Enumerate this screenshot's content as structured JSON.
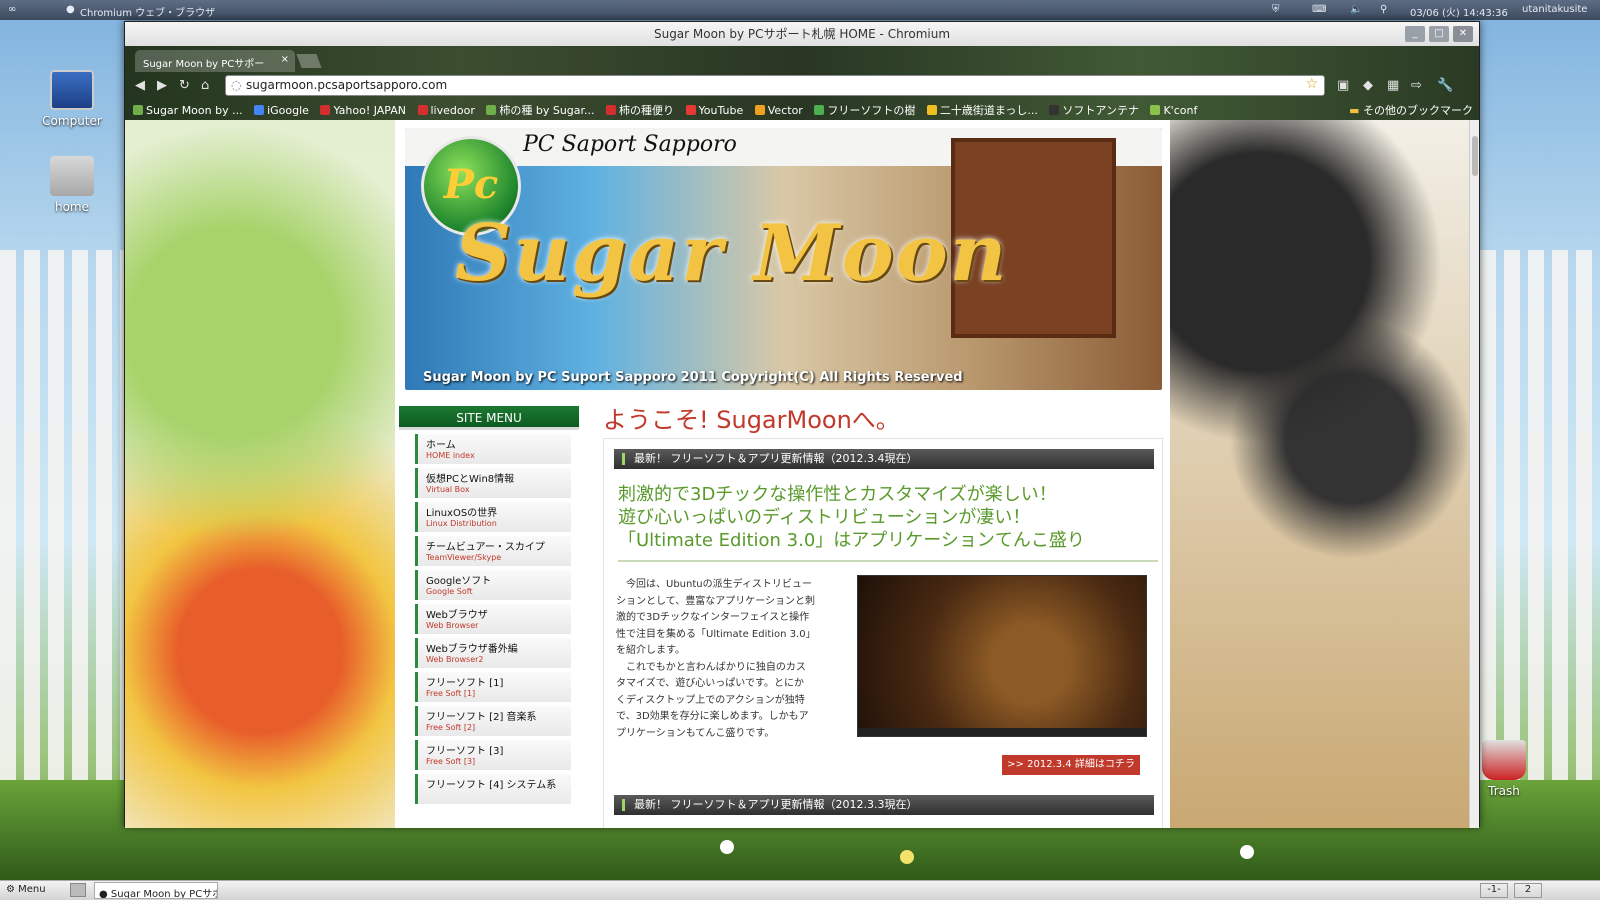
{
  "top_panel": {
    "left_title": "Chromium ウェブ・ブラウザ",
    "datetime": "03/06 (火) 14:43:36",
    "user": "utanitakusite"
  },
  "desktop": {
    "icons": [
      {
        "label": "Computer",
        "icon": "computer-icon"
      },
      {
        "label": "home",
        "icon": "home-folder-icon"
      },
      {
        "label": "Trash",
        "icon": "trash-icon"
      }
    ]
  },
  "window": {
    "title": "Sugar Moon by PCサポート札幌 HOME - Chromium",
    "tab_label": "Sugar Moon by PCサポー",
    "url": "sugarmoon.pcsaportsapporo.com",
    "bookmarks": [
      {
        "label": "Sugar Moon by ...",
        "color": "#6fae4a"
      },
      {
        "label": "iGoogle",
        "color": "#4285f4"
      },
      {
        "label": "Yahoo! JAPAN",
        "color": "#d32f2f"
      },
      {
        "label": "livedoor",
        "color": "#d32f2f"
      },
      {
        "label": "柿の種 by Sugar...",
        "color": "#6fae4a"
      },
      {
        "label": "柿の種便り",
        "color": "#d32f2f"
      },
      {
        "label": "YouTube",
        "color": "#e53935"
      },
      {
        "label": "Vector",
        "color": "#f0a020"
      },
      {
        "label": "フリーソフトの樹",
        "color": "#4caf50"
      },
      {
        "label": "二十歳街道まっし...",
        "color": "#f0c020"
      },
      {
        "label": "ソフトアンテナ",
        "color": "#333333"
      },
      {
        "label": "K'conf",
        "color": "#8bc34a"
      }
    ],
    "other_bookmarks": "その他のブックマーク"
  },
  "page": {
    "banner": {
      "site_name": "PC Saport Sapporo",
      "logo": "Pc",
      "title": "Sugar Moon",
      "copyright": "Sugar Moon by PC Suport Sapporo 2011 Copyright(C) All Rights Reserved"
    },
    "site_menu": {
      "header": "SITE MENU",
      "items": [
        {
          "ja": "ホーム",
          "en": "HOME index"
        },
        {
          "ja": "仮想PCとWin8情報",
          "en": "Virtual Box"
        },
        {
          "ja": "LinuxOSの世界",
          "en": "Linux Distribution"
        },
        {
          "ja": "チームビュアー・スカイプ",
          "en": "TeamViewer/Skype"
        },
        {
          "ja": "Googleソフト",
          "en": "Google Soft"
        },
        {
          "ja": "Webブラウザ",
          "en": "Web Browser"
        },
        {
          "ja": "Webブラウザ番外編",
          "en": "Web Browser2"
        },
        {
          "ja": "フリーソフト [1]",
          "en": "Free Soft [1]"
        },
        {
          "ja": "フリーソフト [2] 音楽系",
          "en": "Free Soft [2]"
        },
        {
          "ja": "フリーソフト [3]",
          "en": "Free Soft [3]"
        },
        {
          "ja": "フリーソフト [4] システム系",
          "en": ""
        }
      ]
    },
    "welcome": "ようこそ! SugarMoonへ。",
    "news": [
      {
        "title": "最新！ フリーソフト＆アプリ更新情報（2012.3.4現在）"
      },
      {
        "title": "最新！ フリーソフト＆アプリ更新情報（2012.3.3現在）"
      }
    ],
    "headline": [
      "刺激的で3Dチックな操作性とカスタマイズが楽しい！",
      "遊び心いっぱいのディストリビューションが凄い！",
      "「Ultimate Edition 3.0」はアプリケーションてんこ盛り"
    ],
    "body": [
      "　今回は、Ubuntuの派生ディストリビュー",
      "ションとして、豊富なアプリケーションと刺",
      "激的で3Dチックなインターフェイスと操作",
      "性で注目を集める「Ultimate Edition 3.0」",
      "を紹介します。",
      "　これでもかと言わんばかりに独自のカス",
      "タマイズで、遊び心いっぱいです。とにか",
      "くディスクトップ上でのアクションが独特",
      "で、3D効果を存分に楽しめます。しかもア",
      "プリケーションもてんこ盛りです。"
    ],
    "detail_button": ">> 2012.3.4 詳細はコチラ"
  },
  "bottom_panel": {
    "menu": "Menu",
    "task": "Sugar Moon by PCサポ...",
    "workspaces": [
      "-1-",
      "2"
    ]
  },
  "colors": {
    "accent_green": "#2d8a3d",
    "headline_green": "#5a9a2c",
    "welcome_red": "#c0392b"
  }
}
